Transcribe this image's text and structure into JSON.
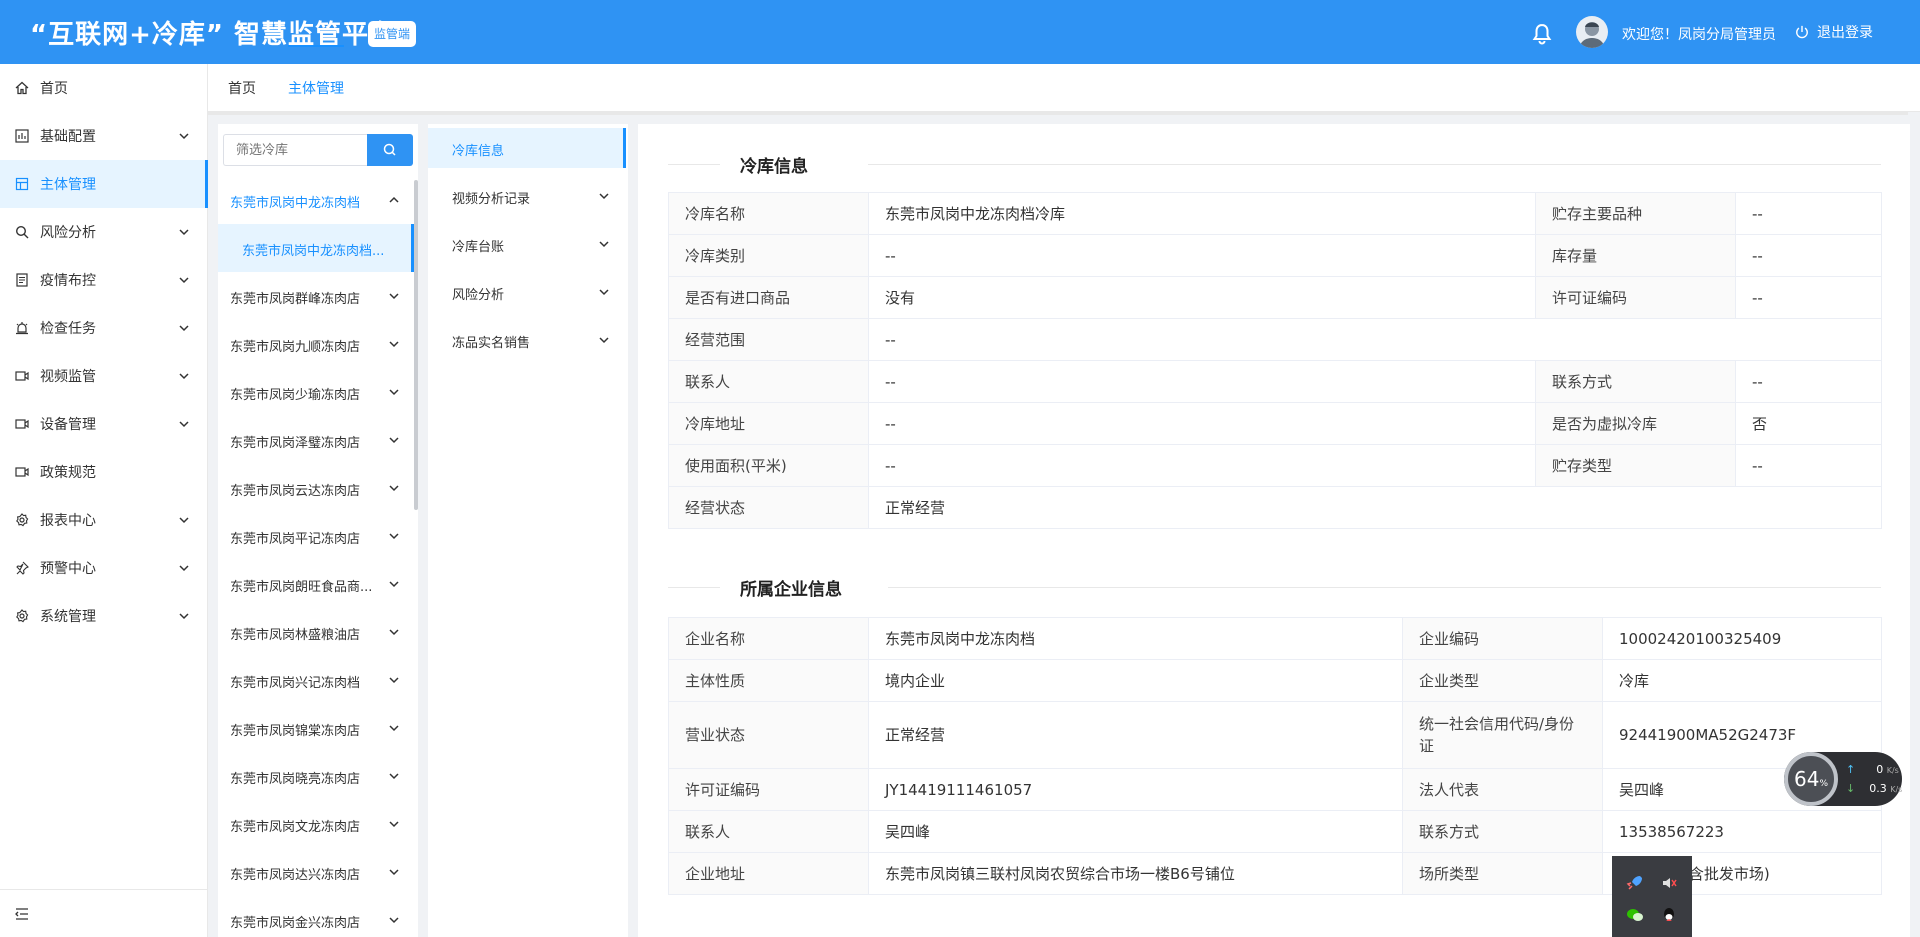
{
  "header": {
    "title": "“互联网+冷库” 智慧监管平台",
    "badge": "监管端",
    "welcome": "欢迎您！凤岗分局管理员",
    "logout": "退出登录"
  },
  "sidebar": {
    "items": [
      {
        "label": "首页",
        "icon": "home-icon"
      },
      {
        "label": "基础配置",
        "icon": "config-icon"
      },
      {
        "label": "主体管理",
        "icon": "building-icon"
      },
      {
        "label": "风险分析",
        "icon": "search-icon"
      },
      {
        "label": "疫情布控",
        "icon": "document-icon"
      },
      {
        "label": "检查任务",
        "icon": "alarm-icon"
      },
      {
        "label": "视频监管",
        "icon": "video-icon"
      },
      {
        "label": "设备管理",
        "icon": "device-icon"
      },
      {
        "label": "政策规范",
        "icon": "policy-icon"
      },
      {
        "label": "报表中心",
        "icon": "gear-icon"
      },
      {
        "label": "预警中心",
        "icon": "pin-icon"
      },
      {
        "label": "系统管理",
        "icon": "settings-icon"
      }
    ]
  },
  "tabs": [
    {
      "label": "首页"
    },
    {
      "label": "主体管理"
    }
  ],
  "store_list": {
    "search_placeholder": "筛选冷库",
    "expanded_parent": "东莞市凤岗中龙冻肉档",
    "selected_child": "东莞市凤岗中龙冻肉档...",
    "items": [
      "东莞市凤岗群峰冻肉店",
      "东莞市凤岗九顺冻肉店",
      "东莞市凤岗少瑜冻肉店",
      "东莞市凤岗泽璧冻肉店",
      "东莞市凤岗云达冻肉店",
      "东莞市凤岗平记冻肉店",
      "东莞市凤岗朗旺食品商...",
      "东莞市凤岗林盛粮油店",
      "东莞市凤岗兴记冻肉档",
      "东莞市凤岗锦棠冻肉店",
      "东莞市凤岗晓亮冻肉店",
      "东莞市凤岗文龙冻肉店",
      "东莞市凤岗达兴冻肉店",
      "东莞市凤岗金兴冻肉店"
    ]
  },
  "categories": [
    {
      "label": "冷库信息"
    },
    {
      "label": "视频分析记录"
    },
    {
      "label": "冷库台账"
    },
    {
      "label": "风险分析"
    },
    {
      "label": "冻品实名销售"
    }
  ],
  "coldstore": {
    "title": "冷库信息",
    "rows": [
      {
        "k1": "冷库名称",
        "v1": "东莞市凤岗中龙冻肉档冷库",
        "k2": "贮存主要品种",
        "v2": "--"
      },
      {
        "k1": "冷库类别",
        "v1": "--",
        "k2": "库存量",
        "v2": "--"
      },
      {
        "k1": "是否有进口商品",
        "v1": "没有",
        "k2": "许可证编码",
        "v2": "--"
      },
      {
        "k1": "经营范围",
        "v1": "--"
      },
      {
        "k1": "联系人",
        "v1": "--",
        "k2": "联系方式",
        "v2": "--"
      },
      {
        "k1": "冷库地址",
        "v1": "--",
        "k2": "是否为虚拟冷库",
        "v2": "否"
      },
      {
        "k1": "使用面积(平米)",
        "v1": "--",
        "k2": "贮存类型",
        "v2": "--"
      },
      {
        "k1": "经营状态",
        "v1": "正常经营"
      }
    ]
  },
  "enterprise": {
    "title": "所属企业信息",
    "rows": [
      {
        "k1": "企业名称",
        "v1": "东莞市凤岗中龙冻肉档",
        "k2": "企业编码",
        "v2": "10002420100325409"
      },
      {
        "k1": "主体性质",
        "v1": "境内企业",
        "k2": "企业类型",
        "v2": "冷库"
      },
      {
        "k1": "营业状态",
        "v1": "正常经营",
        "k2": "统一社会信用代码/身份证",
        "v2": "92441900MA52G2473F"
      },
      {
        "k1": "许可证编码",
        "v1": "JY14419111461057",
        "k2": "法人代表",
        "v2": "吴四峰"
      },
      {
        "k1": "联系人",
        "v1": "吴四峰",
        "k2": "联系方式",
        "v2": "13538567223"
      },
      {
        "k1": "企业地址",
        "v1": "东莞市凤岗镇三联村凤岗农贸综合市场一楼B6号铺位",
        "k2": "场所类型",
        "v2": "(含批发市场)"
      }
    ]
  },
  "speed_widget": {
    "percent": "64",
    "percent_unit": "%",
    "up": "0",
    "down": "0.3",
    "unit": "K/s"
  },
  "colors": {
    "primary": "#2f93f3",
    "active": "#1890ff",
    "active_bg": "#e6f4ff"
  }
}
